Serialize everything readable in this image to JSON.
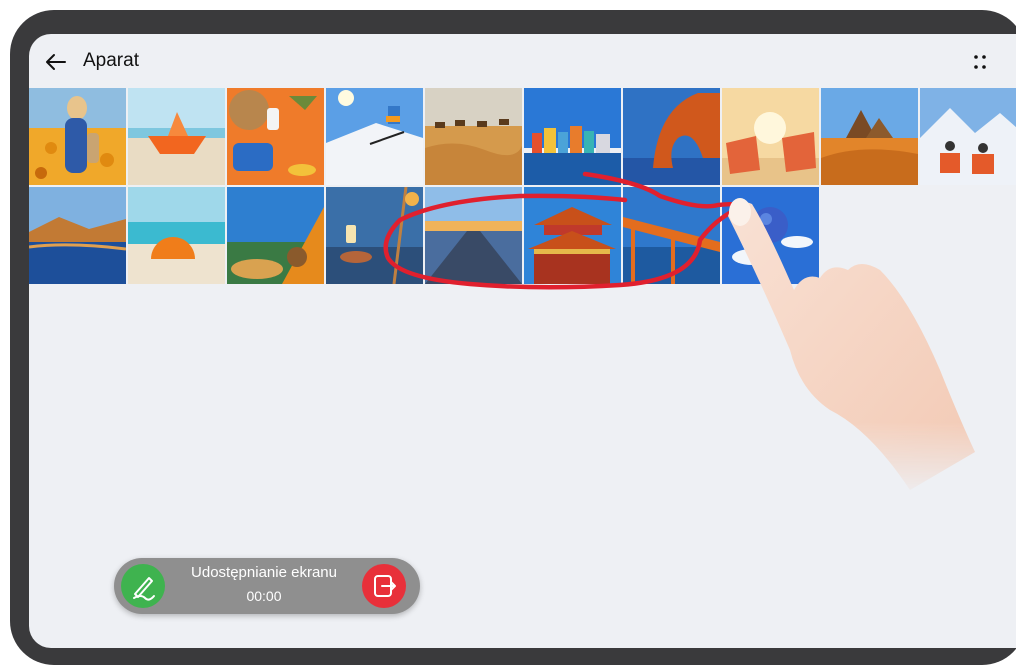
{
  "header": {
    "title": "Aparat",
    "back_icon": "arrow-left-icon",
    "menu_icon": "more-dots-icon"
  },
  "gallery": {
    "rows": [
      [
        "woman-sunflowers",
        "paper-boat-beach",
        "beach-flatlay",
        "skier",
        "desert-camels",
        "colorful-harbor",
        "red-rock-arch",
        "beach-chairs-sunset",
        "desert-dunes",
        "snow-chairs"
      ],
      [
        "lake-mountains",
        "orange-umbrella",
        "tent-lake",
        "lantern-lake",
        "highway-horizon",
        "chinese-temple",
        "orange-bridge",
        "blue-balloon"
      ]
    ]
  },
  "share_bar": {
    "label": "Udostępnianie ekranu",
    "time": "00:00",
    "pen_icon": "pen-icon",
    "exit_icon": "exit-icon"
  },
  "colors": {
    "annotation": "#e0202e",
    "pen_button": "#3fb34f",
    "exit_button": "#e8303a",
    "screen_bg": "#eef0f4"
  }
}
